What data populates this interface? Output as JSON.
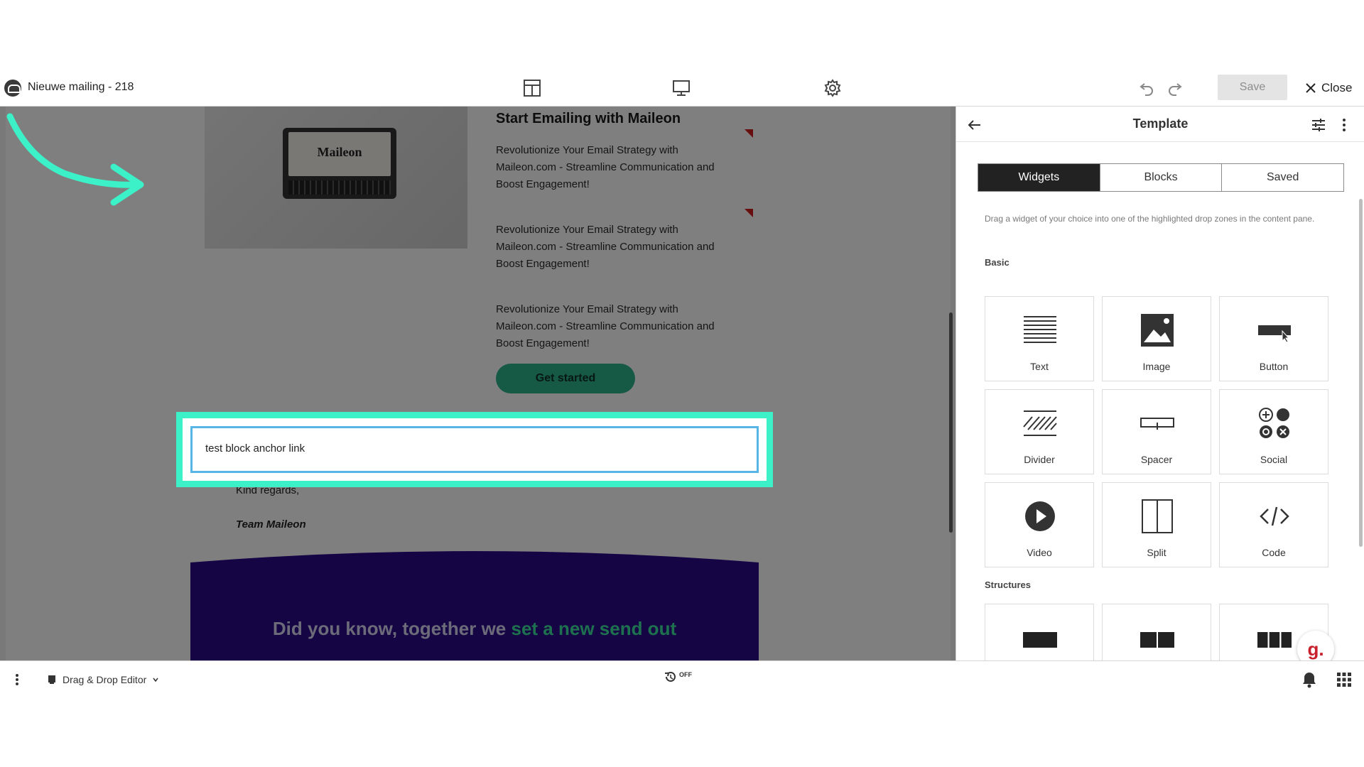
{
  "window": {
    "title": "Nieuwe mailing - 218"
  },
  "toolbar": {
    "layout_icon": "layout-icon",
    "desktop_icon": "desktop-preview-icon",
    "settings_icon": "gear-icon",
    "undo_icon": "undo-icon",
    "redo_icon": "redo-icon",
    "save_label": "Save",
    "close_label": "Close"
  },
  "email": {
    "headline": "Start Emailing with Maileon",
    "paragraphs": [
      "Revolutionize Your Email Strategy with Maileon.com - Streamline Communication and Boost Engagement!",
      "Revolutionize Your Email Strategy with Maileon.com - Streamline Communication and Boost Engagement!",
      "Revolutionize Your Email Strategy with Maileon.com - Streamline Communication and Boost Engagement!"
    ],
    "cta_label": "Get started",
    "anchor_text": "test block anchor link",
    "regards": "Kind regards,",
    "signature": "Team Maileon",
    "banner_text": "Did you know, together we ",
    "banner_accent": "set a new send out",
    "hero_image_logo": "Maileon",
    "colors": {
      "cta": "#2db38a",
      "highlight": "#3cf0c8",
      "banner": "#2d0a8a"
    }
  },
  "panel": {
    "title": "Template",
    "tabs": [
      {
        "label": "Widgets",
        "active": true
      },
      {
        "label": "Blocks",
        "active": false
      },
      {
        "label": "Saved",
        "active": false
      }
    ],
    "help_text": "Drag a widget of your choice into one of the highlighted drop zones in the content pane.",
    "basic_label": "Basic",
    "structures_label": "Structures",
    "widgets": [
      {
        "label": "Text",
        "icon": "text-icon"
      },
      {
        "label": "Image",
        "icon": "image-icon"
      },
      {
        "label": "Button",
        "icon": "button-icon"
      },
      {
        "label": "Divider",
        "icon": "divider-icon"
      },
      {
        "label": "Spacer",
        "icon": "spacer-icon"
      },
      {
        "label": "Social",
        "icon": "social-icon"
      },
      {
        "label": "Video",
        "icon": "video-icon"
      },
      {
        "label": "Split",
        "icon": "split-icon"
      },
      {
        "label": "Code",
        "icon": "code-icon"
      }
    ],
    "structures": [
      {
        "icon": "one-column-icon"
      },
      {
        "icon": "two-column-icon"
      },
      {
        "icon": "three-column-icon"
      }
    ],
    "badge": "g."
  },
  "bottombar": {
    "editor_label": "Drag & Drop Editor",
    "autosave_label": "OFF"
  }
}
